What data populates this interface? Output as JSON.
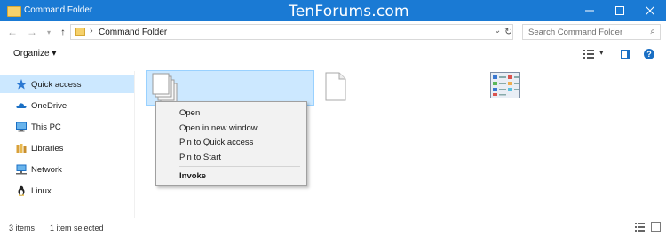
{
  "window": {
    "title": "Command Folder",
    "watermark": "TenForums.com",
    "controls": [
      "minimize",
      "maximize",
      "close"
    ]
  },
  "address_bar": {
    "path": "Command Folder",
    "search_placeholder": "Search Command Folder"
  },
  "toolbar": {
    "organize_label": "Organize"
  },
  "nav_pane": {
    "items": [
      {
        "label": "Quick access",
        "icon": "star-icon",
        "selected": true
      },
      {
        "label": "OneDrive",
        "icon": "cloud-icon",
        "selected": false
      },
      {
        "label": "This PC",
        "icon": "computer-icon",
        "selected": false
      },
      {
        "label": "Libraries",
        "icon": "libraries-icon",
        "selected": false
      },
      {
        "label": "Network",
        "icon": "network-icon",
        "selected": false
      },
      {
        "label": "Linux",
        "icon": "linux-penguin-icon",
        "selected": false
      }
    ]
  },
  "context_menu": {
    "items": [
      "Open",
      "Open in new window",
      "Pin to Quick access",
      "Pin to Start"
    ],
    "default_item": "Invoke"
  },
  "status_bar": {
    "item_count": "3 items",
    "selection": "1 item selected"
  },
  "colors": {
    "titlebar": "#1a7ad4",
    "selection": "#cce8ff",
    "accent": "#1a6fc4"
  }
}
